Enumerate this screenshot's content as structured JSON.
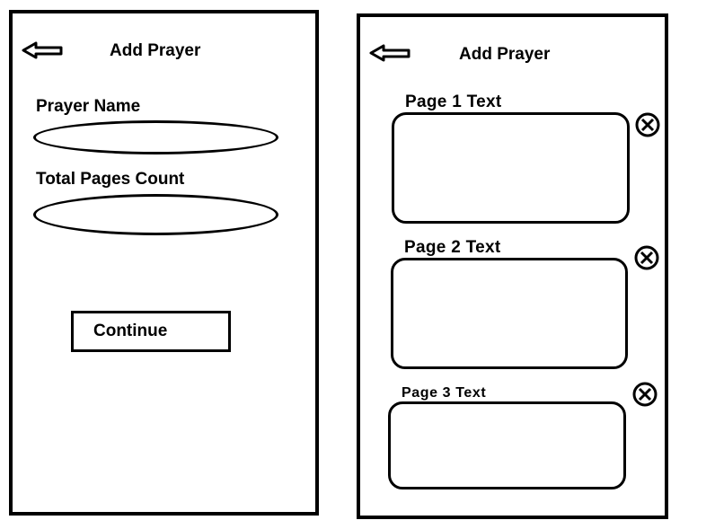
{
  "form_screen": {
    "title": "Add Prayer",
    "back_icon": "back-arrow-icon",
    "prayer_name": {
      "label": "Prayer Name",
      "value": ""
    },
    "total_pages": {
      "label": "Total Pages Count",
      "value": ""
    },
    "continue_label": "Continue"
  },
  "pages_screen": {
    "title": "Add Prayer",
    "back_icon": "back-arrow-icon",
    "remove_icon": "circle-x-icon",
    "pages": [
      {
        "label": "Page 1 Text",
        "value": ""
      },
      {
        "label": "Page 2 Text",
        "value": ""
      },
      {
        "label": "Page 3 Text",
        "value": ""
      }
    ]
  }
}
